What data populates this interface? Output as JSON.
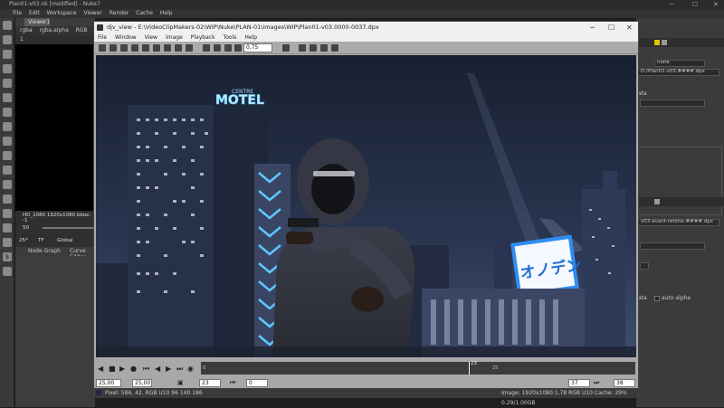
{
  "nuke": {
    "title": "Plan01-v03.nk [modified] - Nuke7",
    "menu": [
      "File",
      "Edit",
      "Workspace",
      "Viewer",
      "Render",
      "Cache",
      "Help"
    ],
    "viewer_tab": "Viewer1",
    "channel": "rgba",
    "alpha": "rgba.alpha",
    "colorspace": "RGB",
    "frame_field": "1",
    "format_text": "HD_1080 1920x1080  bbox: -1",
    "gain_label": "50",
    "frame_label": "25*",
    "rate_label": "TF",
    "global_label": "Global",
    "node_graph_tab": "Node Graph",
    "curve_editor_tab": "Curve Editor",
    "right_panel": {
      "none_option": "none",
      "path1": "D:/Plan01-v03.####.dpx",
      "path2": "v03-avant-retime.####.dpx",
      "data_label": "ata",
      "auto_alpha_label": "auto alpha",
      "read_label": "ata"
    }
  },
  "djv": {
    "title": "djv_view - E:\\VideoClipMakers-02\\WIP\\Nuke\\PLAN-01\\images\\WIP\\Plan01-v03.0000-0037.dpx",
    "menu": [
      "File",
      "Window",
      "View",
      "Image",
      "Playback",
      "Tools",
      "Help"
    ],
    "zoom": "0,75",
    "timeline_current": "23",
    "timeline_ticks": [
      "0",
      "25"
    ],
    "speed": "25,00",
    "speed_actual": "25,00",
    "current_frame": "23",
    "start_frame": "0",
    "end_frame": "37",
    "duration": "38",
    "pixel_info": "Pixel: 586, 42, RGB U10 96 140 186",
    "image_info": "Image: 1920x1080:1,78 RGB U10  Cache: 29% 0.29/1.00GB"
  },
  "signs": {
    "motel_small": "CENTRE",
    "motel_big": "MOTEL",
    "japanese": "オノデン"
  },
  "colors": {
    "sky_top": "#1a2233",
    "sky_bottom": "#3d4b6a",
    "neon_blue": "#5cc8ff",
    "sign_blue": "#2e8df0"
  }
}
